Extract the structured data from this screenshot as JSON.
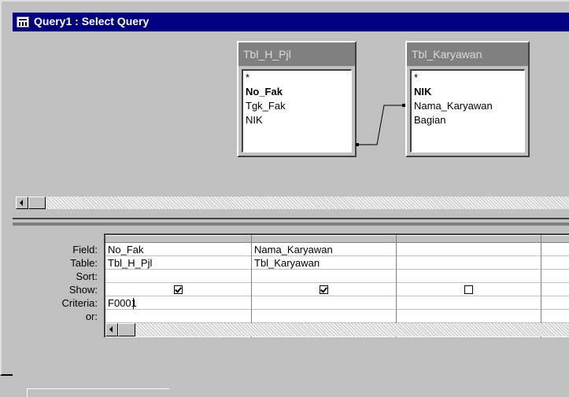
{
  "window": {
    "title": "Query1 : Select Query",
    "title_bar_color": "#000080"
  },
  "tables": [
    {
      "name": "Tbl_H_Pjl",
      "fields": [
        {
          "label": "*",
          "key": false
        },
        {
          "label": "No_Fak",
          "key": true
        },
        {
          "label": "Tgk_Fak",
          "key": false
        },
        {
          "label": "NIK",
          "key": false
        }
      ]
    },
    {
      "name": "Tbl_Karyawan",
      "fields": [
        {
          "label": "*",
          "key": false
        },
        {
          "label": "NIK",
          "key": true
        },
        {
          "label": "Nama_Karyawan",
          "key": false
        },
        {
          "label": "Bagian",
          "key": false
        }
      ]
    }
  ],
  "relationship": {
    "from": "Tbl_H_Pjl.NIK",
    "to": "Tbl_Karyawan.NIK"
  },
  "design_grid": {
    "row_labels": {
      "field": "Field:",
      "table": "Table:",
      "sort": "Sort:",
      "show": "Show:",
      "criteria": "Criteria:",
      "or": "or:"
    },
    "columns": [
      {
        "field": "No_Fak",
        "table": "Tbl_H_Pjl",
        "sort": "",
        "show": true,
        "criteria": "F0001",
        "or": ""
      },
      {
        "field": "Nama_Karyawan",
        "table": "Tbl_Karyawan",
        "sort": "",
        "show": true,
        "criteria": "",
        "or": ""
      },
      {
        "field": "",
        "table": "",
        "sort": "",
        "show": false,
        "criteria": "",
        "or": ""
      },
      {
        "field": "",
        "table": "",
        "sort": "",
        "show": false,
        "criteria": "",
        "or": ""
      }
    ]
  },
  "icons": {
    "title_icon": "query-icon",
    "scroll_left": "arrow-left-icon",
    "checkbox": "checkbox-icon"
  }
}
